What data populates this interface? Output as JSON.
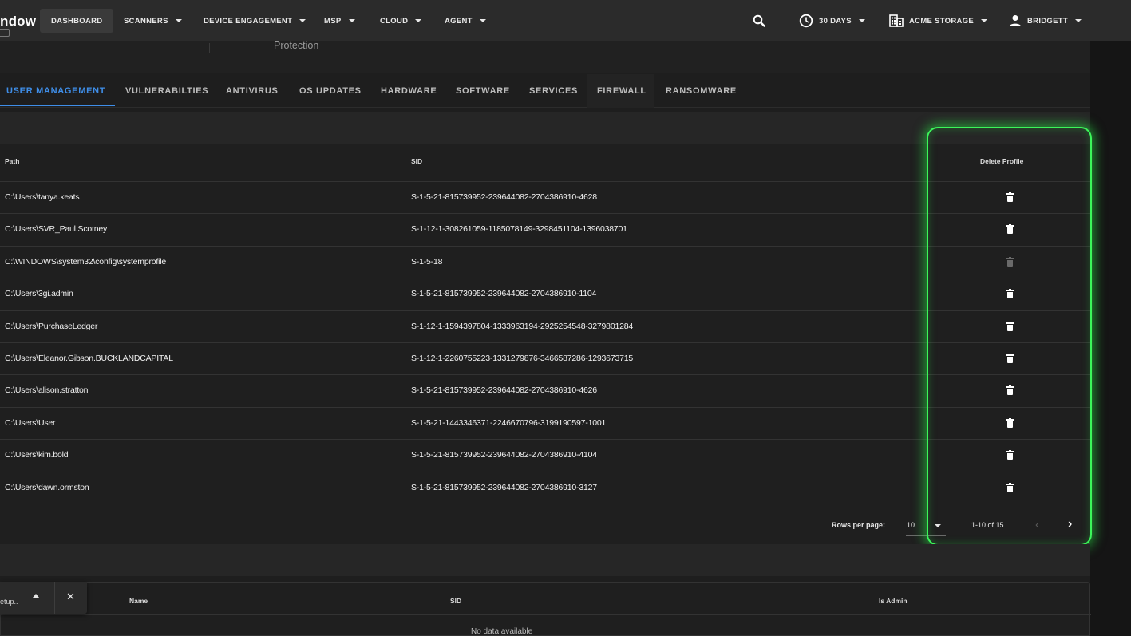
{
  "app": {
    "logo_text": "ndow"
  },
  "navbar": {
    "items": [
      {
        "label": "Dashboard"
      },
      {
        "label": "Scanners"
      },
      {
        "label": "Device Engagement"
      },
      {
        "label": "MSP"
      },
      {
        "label": "Cloud"
      },
      {
        "label": "Agent"
      }
    ],
    "time_range": "30 DAYS",
    "company": "ACME STORAGE",
    "user": "BRIDGETT"
  },
  "header": {
    "subtitle": "Protection"
  },
  "tabs": [
    {
      "label": "User Management"
    },
    {
      "label": "Vulnerabilties"
    },
    {
      "label": "Antivirus"
    },
    {
      "label": "OS Updates"
    },
    {
      "label": "Hardware"
    },
    {
      "label": "Software"
    },
    {
      "label": "Services"
    },
    {
      "label": "Firewall"
    },
    {
      "label": "Ransomware"
    }
  ],
  "profiles_table": {
    "columns": {
      "path": "Path",
      "sid": "SID",
      "delete": "Delete Profile"
    },
    "rows": [
      {
        "path": "C:\\Users\\tanya.keats",
        "sid": "S-1-5-21-815739952-239644082-2704386910-4628",
        "deletable": true
      },
      {
        "path": "C:\\Users\\SVR_Paul.Scotney",
        "sid": "S-1-12-1-308261059-1185078149-3298451104-1396038701",
        "deletable": true
      },
      {
        "path": "C:\\WINDOWS\\system32\\config\\systemprofile",
        "sid": "S-1-5-18",
        "deletable": false
      },
      {
        "path": "C:\\Users\\3gi.admin",
        "sid": "S-1-5-21-815739952-239644082-2704386910-1104",
        "deletable": true
      },
      {
        "path": "C:\\Users\\PurchaseLedger",
        "sid": "S-1-12-1-1594397804-1333963194-2925254548-3279801284",
        "deletable": true
      },
      {
        "path": "C:\\Users\\Eleanor.Gibson.BUCKLANDCAPITAL",
        "sid": "S-1-12-1-2260755223-1331279876-3466587286-1293673715",
        "deletable": true
      },
      {
        "path": "C:\\Users\\alison.stratton",
        "sid": "S-1-5-21-815739952-239644082-2704386910-4626",
        "deletable": true
      },
      {
        "path": "C:\\Users\\User",
        "sid": "S-1-5-21-1443346371-2246670796-3199190597-1001",
        "deletable": true
      },
      {
        "path": "C:\\Users\\kim.bold",
        "sid": "S-1-5-21-815739952-239644082-2704386910-4104",
        "deletable": true
      },
      {
        "path": "C:\\Users\\dawn.ormston",
        "sid": "S-1-5-21-815739952-239644082-2704386910-3127",
        "deletable": true
      }
    ],
    "pagination": {
      "rows_per_page_label": "Rows per page:",
      "rows_per_page": "10",
      "range": "1-10 of 15"
    }
  },
  "admins_table": {
    "columns": {
      "name": "Name",
      "sid": "SID",
      "is_admin": "Is Admin"
    },
    "empty_text": "No data available"
  },
  "setup_popup": {
    "label": "etup.."
  },
  "colors": {
    "accent": "#3f8ee8",
    "highlight": "#3cf55a",
    "background": "#1e1e1e"
  }
}
